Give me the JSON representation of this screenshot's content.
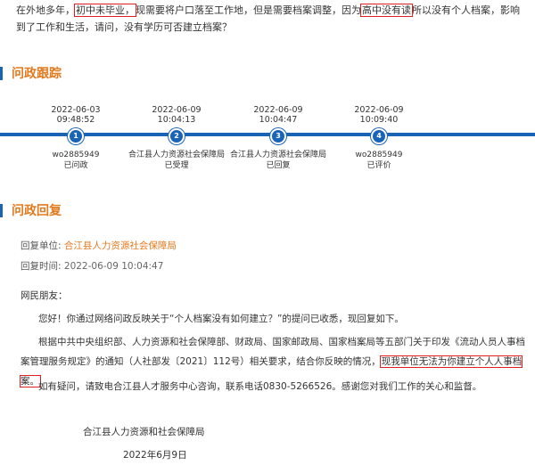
{
  "question": {
    "part1": "在外地多年，",
    "hl1": "初中未毕业，",
    "part2": "现需要将户口落至工作地，但是需要档案调整，因为",
    "hl2": "高中没有读",
    "part3": "所以没有个人档案，影响到了工作和生活，请问，没有学历可否建立档案？"
  },
  "tracking": {
    "title": "问政跟踪",
    "steps": [
      {
        "date": "2022-06-03",
        "time": "09:48:52",
        "num": "1",
        "actor": "wo2885949",
        "status": "已问政"
      },
      {
        "date": "2022-06-09",
        "time": "10:04:13",
        "num": "2",
        "actor": "合江县人力资源社会保障局",
        "status": "已受理"
      },
      {
        "date": "2022-06-09",
        "time": "10:04:47",
        "num": "3",
        "actor": "合江县人力资源社会保障局",
        "status": "已回复"
      },
      {
        "date": "2022-06-09",
        "time": "10:09:40",
        "num": "4",
        "actor": "wo2885949",
        "status": "已评价"
      }
    ]
  },
  "reply": {
    "title": "问政回复",
    "unit_label": "回复单位:",
    "unit_value": "合江县人力资源社会保障局",
    "time_label": "回复时间:",
    "time_value": "2022-06-09 10:04:47",
    "greeting": "网民朋友：",
    "para1": "您好！你通过网络问政反映关于“个人档案没有如何建立？”的提问已收悉，现回复如下。",
    "para2_a": "根据中共中央组织部、人力资源和社会保障部、财政局、国家邮政局、国家档案局等五部门关于印发《流动人员人事档案管理服务规定》的通知（人社部发〔2021〕112号）相关要求，结合你反映的情况，",
    "para2_hl": "现我单位无法为你建立个人人事档案。",
    "para3": "如有疑问，请致电合江县人才服务中心咨询，联系电话0830-5266526。感谢您对我们工作的关心和监督。",
    "sign_org": "合江县人力资源和社会保障局",
    "sign_date": "2022年6月9日"
  },
  "colors": {
    "accent_blue": "#1a64b8",
    "accent_orange": "#e27a1f",
    "highlight_red": "#e02020"
  }
}
